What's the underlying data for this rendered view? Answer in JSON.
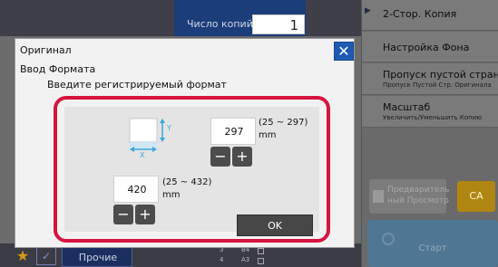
{
  "background": {
    "copies_label": "Число копий",
    "copies_value": "1",
    "right_panel": [
      {
        "title": "2-Стор. Копия",
        "subtitle": ""
      },
      {
        "title": "Настройка Фона",
        "subtitle": ""
      },
      {
        "title": "Пропуск пустой страници",
        "subtitle": "Пропуск Пустой Стр. Оригинала"
      },
      {
        "title": "Масштаб",
        "subtitle": "Увеличить/Уменьшить Копию"
      }
    ],
    "preview_label_line1": "Предваритель",
    "preview_label_line2": "ный Просмотр",
    "ca_label": "CA",
    "start_label": "Старт",
    "other_label": "Прочие",
    "trays": [
      {
        "num": "3",
        "size": "B4"
      },
      {
        "num": "4",
        "size": "A3"
      }
    ]
  },
  "dialog": {
    "title": "Оригинал",
    "subtitle": "Ввод Формата",
    "instruction": "Введите регистрируемый формат",
    "y_value": "297",
    "y_range": "(25 ~ 297)",
    "y_unit": "mm",
    "x_value": "420",
    "x_range": "(25 ~ 432)",
    "x_unit": "mm",
    "minus_symbol": "−",
    "plus_symbol": "+",
    "ok_label": "OK",
    "close_symbol": "✕",
    "axis_x": "X",
    "axis_y": "Y"
  },
  "colors": {
    "highlight_frame": "#d6153f",
    "close_button": "#1f5bb3",
    "ca_button": "#b08612"
  }
}
